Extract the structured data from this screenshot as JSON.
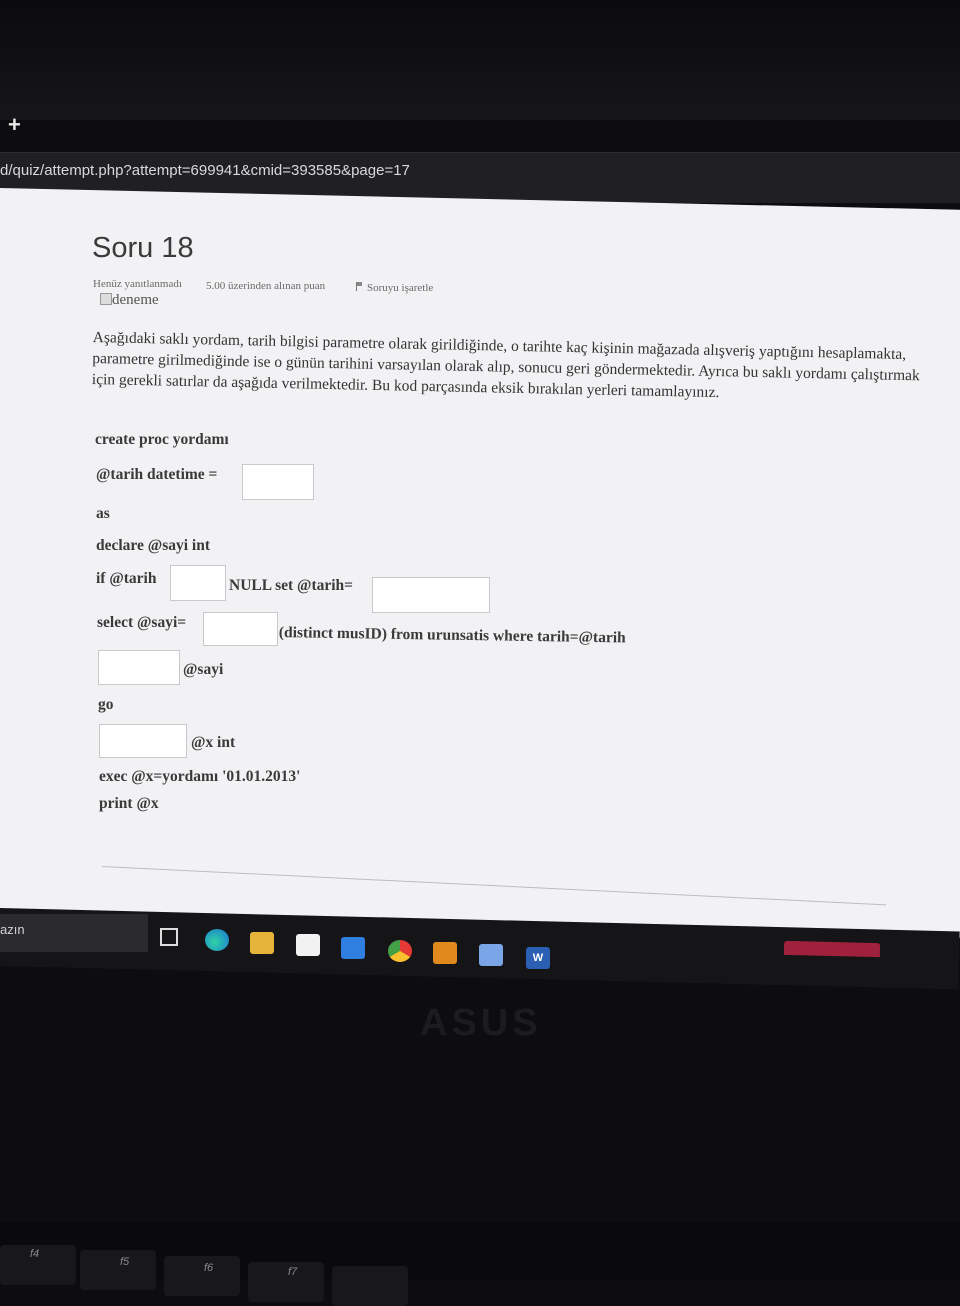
{
  "browser": {
    "new_tab_symbol": "+",
    "url": "d/quiz/attempt.php?attempt=699941&cmid=393585&page=17"
  },
  "question": {
    "title": "Soru 18",
    "status": "Henüz yanıtlanmadı",
    "grade": "5.00 üzerinden alınan puan",
    "flag_label": "Soruyu işaretle",
    "image_alt": "deneme",
    "text": "Aşağıdaki saklı yordam, tarih bilgisi parametre olarak girildiğinde, o tarihte kaç kişinin mağazada alışveriş yaptığını hesaplamakta, parametre girilmediğinde ise o günün tarihini varsayılan olarak alıp, sonucu geri göndermektedir. Ayrıca bu saklı yordamı çalıştırmak için gerekli satırlar da aşağıda verilmektedir. Bu kod parçasında eksik bırakılan yerleri tamamlayınız."
  },
  "code": {
    "line1": "create proc yordamı",
    "line2": "@tarih datetime =",
    "line3": "as",
    "line4": "declare @sayi int",
    "line5a": "if @tarih",
    "line5b": "NULL set @tarih=",
    "line6a": "select @sayi=",
    "line6b": "(distinct musID) from urunsatis where tarih=@tarih",
    "line7": "@sayi",
    "line8": "go",
    "line9": "@x int",
    "line10": "exec @x=yordamı '01.01.2013'",
    "line11": "print @x"
  },
  "taskbar": {
    "search_text": "azın",
    "icons": [
      "task-view-icon",
      "edge-icon",
      "file-explorer-icon",
      "store-icon",
      "mail-icon",
      "chrome-icon",
      "app-icon",
      "remote-desktop-icon",
      "word-icon"
    ]
  },
  "laptop": {
    "brand": "ASUS",
    "fkeys": [
      "f4",
      "f5",
      "f6",
      "f7"
    ]
  }
}
